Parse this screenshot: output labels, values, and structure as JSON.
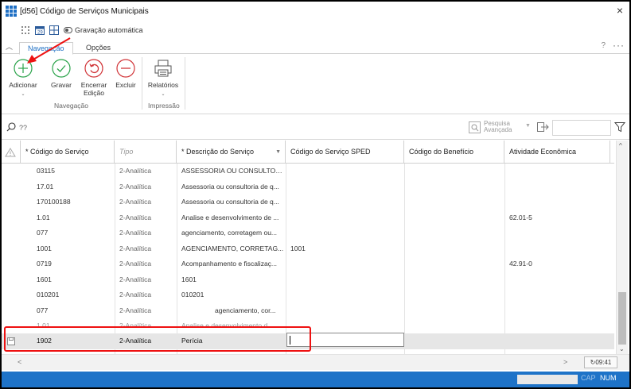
{
  "window": {
    "title": "[d56]  Código de Serviços Municipais",
    "close_label": "×"
  },
  "quickbar": {
    "auto_save_label": "Gravação automática"
  },
  "ribbon_tabs": [
    {
      "label": "Navegação",
      "active": true
    },
    {
      "label": "Opções",
      "active": false
    }
  ],
  "ribbon": {
    "help_label": "?",
    "more_label": "···",
    "buttons": {
      "add": "Adicionar",
      "save": "Gravar",
      "end_edit_1": "Encerrar",
      "end_edit_2": "Edição",
      "delete": "Excluir",
      "reports": "Relatórios"
    },
    "groups": {
      "navigation": "Navegação",
      "print": "Impressão"
    }
  },
  "search": {
    "placeholder": "??",
    "advanced_1": "Pesquisa",
    "advanced_2": "Avançada"
  },
  "grid": {
    "columns": [
      "* Código do Serviço",
      "Tipo",
      "* Descrição do Serviço",
      "Código do Serviço SPED",
      "Código do Benefício",
      "Atividade Econômica"
    ],
    "rows": [
      {
        "code": "03115",
        "type": "2-Analítica",
        "desc": "ASSESSORIA OU CONSULTORI...",
        "sped": "",
        "benefit": "",
        "activity": ""
      },
      {
        "code": "17.01",
        "type": "2-Analítica",
        "desc": "Assessoria ou consultoria de q...",
        "sped": "",
        "benefit": "",
        "activity": ""
      },
      {
        "code": "170100188",
        "type": "2-Analítica",
        "desc": "Assessoria ou consultoria de q...",
        "sped": "",
        "benefit": "",
        "activity": ""
      },
      {
        "code": "1.01",
        "type": "2-Analítica",
        "desc": "Analise e desenvolvimento de ...",
        "sped": "",
        "benefit": "",
        "activity": "62.01-5"
      },
      {
        "code": "077",
        "type": "2-Analítica",
        "desc": "agenciamento, corretagem ou...",
        "sped": "",
        "benefit": "",
        "activity": ""
      },
      {
        "code": "1001",
        "type": "2-Analítica",
        "desc": "AGENCIAMENTO, CORRETAG...",
        "sped": "1001",
        "benefit": "",
        "activity": ""
      },
      {
        "code": "0719",
        "type": "2-Analítica",
        "desc": "Acompanhamento e fiscalizaç...",
        "sped": "",
        "benefit": "",
        "activity": "42.91-0"
      },
      {
        "code": "1601",
        "type": "2-Analítica",
        "desc": "1601",
        "sped": "",
        "benefit": "",
        "activity": ""
      },
      {
        "code": "010201",
        "type": "2-Analítica",
        "desc": "010201",
        "sped": "",
        "benefit": "",
        "activity": ""
      },
      {
        "code": "077",
        "type": "2-Analítica",
        "desc": "agenciamento, cor...",
        "sped": "",
        "benefit": "",
        "activity": ""
      },
      {
        "code": "1.01",
        "type": "2-Analítica",
        "desc": "Analise e desenvolvimento d...",
        "sped": "",
        "benefit": "",
        "activity": ""
      }
    ],
    "new_row": {
      "code": "1902",
      "type": "2-Analítica",
      "desc": "Perícia",
      "sped": ""
    }
  },
  "bottom": {
    "refresh_label": "09:41"
  },
  "statusbar": {
    "cap": "CAP",
    "num": "NUM"
  },
  "colors": {
    "accent": "#1e73c8",
    "highlight": "#e11111"
  }
}
